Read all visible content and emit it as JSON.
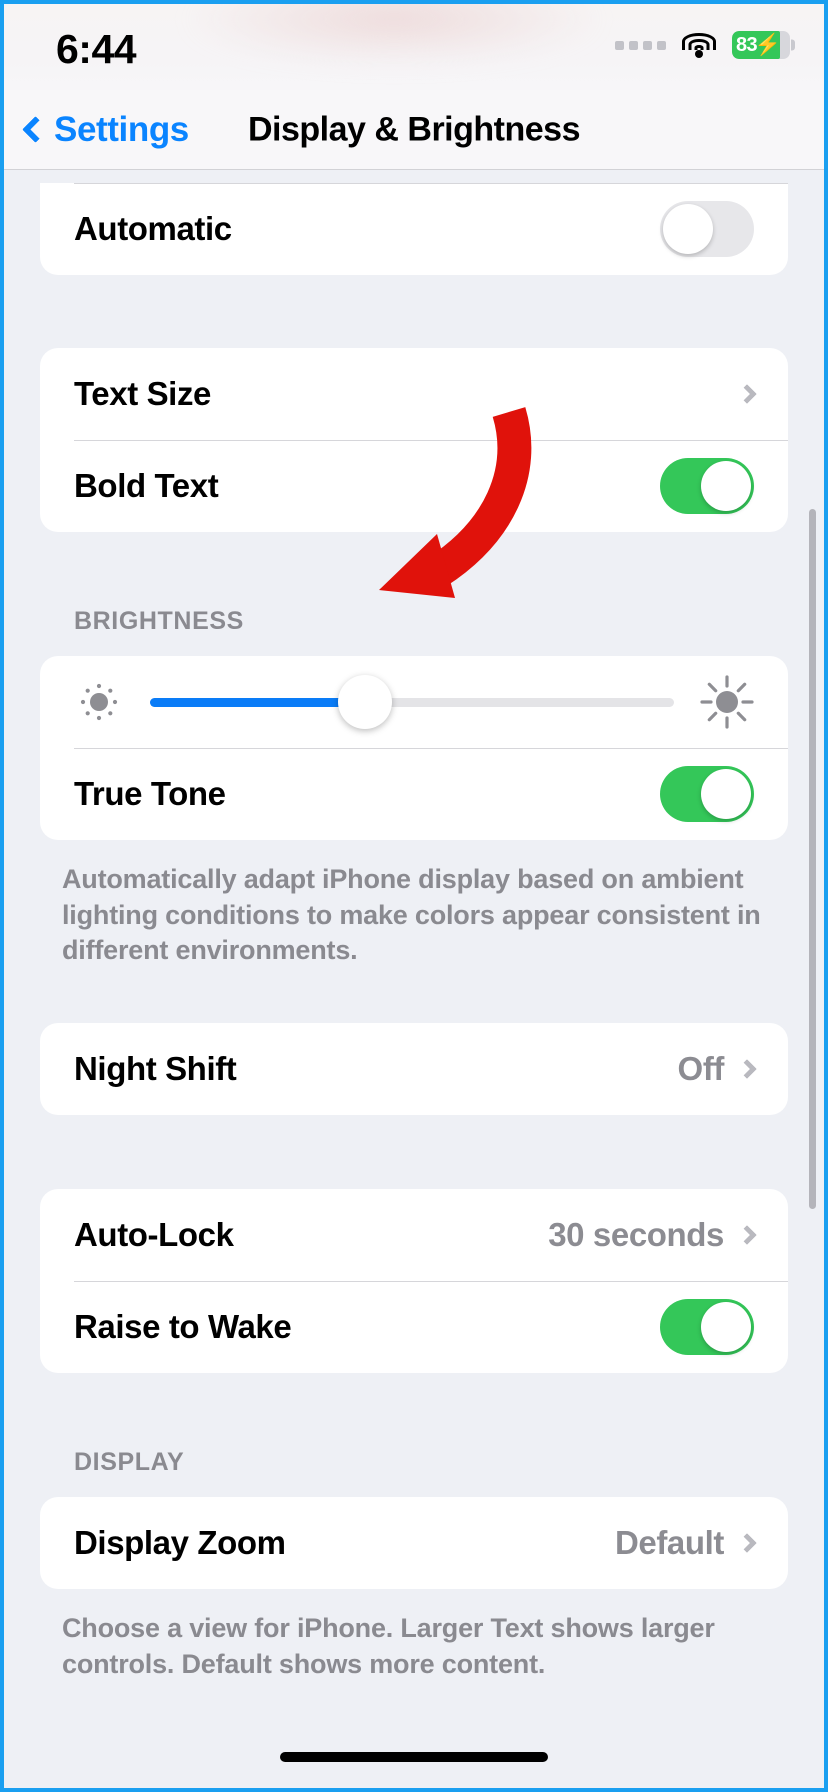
{
  "status_bar": {
    "time": "6:44",
    "battery_percent": "83",
    "battery_level": 83,
    "battery_charging": true,
    "wifi_icon": "wifi-icon",
    "signal_icon": "signal-dots-icon",
    "battery_icon": "battery-icon",
    "accent_green": "#34c759"
  },
  "nav": {
    "back_label": "Settings",
    "back_icon": "chevron-left-icon",
    "title": "Display & Brightness",
    "accent_blue": "#0a84ff"
  },
  "appearance_section": {
    "rows": [
      {
        "label": "Automatic",
        "toggle": "off"
      }
    ]
  },
  "text_section": {
    "rows": [
      {
        "label": "Text Size",
        "value": "",
        "accessory": "chevron-right-icon"
      },
      {
        "label": "Bold Text",
        "toggle": "on"
      }
    ]
  },
  "brightness_section": {
    "header": "BRIGHTNESS",
    "slider": {
      "name": "brightness-slider",
      "value_percent": 41,
      "min_icon": "sun-min-icon",
      "max_icon": "sun-max-icon",
      "fill_color": "#0a7cf7"
    },
    "rows": [
      {
        "label": "True Tone",
        "toggle": "on"
      }
    ],
    "footer": "Automatically adapt iPhone display based on ambient lighting conditions to make colors appear consistent in different environments."
  },
  "night_shift_section": {
    "rows": [
      {
        "label": "Night Shift",
        "value": "Off",
        "accessory": "chevron-right-icon"
      }
    ]
  },
  "lock_section": {
    "rows": [
      {
        "label": "Auto-Lock",
        "value": "30 seconds",
        "accessory": "chevron-right-icon"
      },
      {
        "label": "Raise to Wake",
        "toggle": "on"
      }
    ]
  },
  "display_section": {
    "header": "DISPLAY",
    "rows": [
      {
        "label": "Display Zoom",
        "value": "Default",
        "accessory": "chevron-right-icon"
      }
    ],
    "footer": "Choose a view for iPhone. Larger Text shows larger controls. Default shows more content."
  },
  "annotation": {
    "arrow_color": "#e0120b",
    "arrow_name": "red-annotation-arrow"
  }
}
